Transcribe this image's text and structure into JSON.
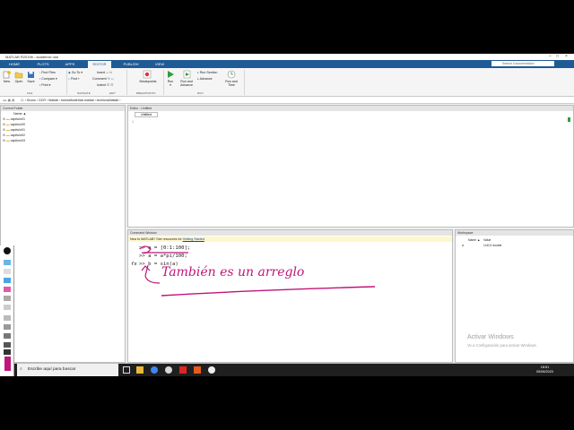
{
  "window": {
    "title": "MATLAB R2019b - academic use"
  },
  "tabs": [
    "HOME",
    "PLOTS",
    "APPS",
    "EDITOR",
    "PUBLISH",
    "VIEW"
  ],
  "search_placeholder": "Search Documentation",
  "ribbon": {
    "file": {
      "new": "New",
      "open": "Open",
      "save": "Save",
      "find_files": "Find Files",
      "compare": "Compare",
      "print": "Print",
      "group": "FILE"
    },
    "navigate": {
      "insert": "Insert",
      "comment": "Comment",
      "indent": "Indent",
      "go_to": "Go To",
      "find": "Find",
      "group": "NAVIGATE"
    },
    "edit_group": "EDIT",
    "breakpoints": {
      "label": "Breakpoints",
      "group": "BREAKPOINTS"
    },
    "run": {
      "run": "Run",
      "run_and_advance": "Run and Advance",
      "run_section": "Run Section",
      "advance": "Advance",
      "run_and_time": "Run and Time",
      "group": "RUN"
    }
  },
  "address_path": "C: › Bruno › GCR › Matlab › tutorialfolderlab-matlab › ArchivosMatlab ›",
  "current_folder": {
    "title": "Current Folder",
    "column": "Name ▲",
    "items": [
      "capitulo01",
      "capitulo00",
      "capitulo01",
      "capitulo02",
      "capitulo03"
    ]
  },
  "editor": {
    "title": "Editor - Untitled",
    "tab": "Untitled",
    "line_number": "1"
  },
  "command_window": {
    "title": "Command Window",
    "notice_text": "New to MATLAB? See resources for ",
    "notice_link": "Getting Started",
    "lines": [
      ">> a = [0:1:100];",
      ">> a = a*pi/100;",
      ">> b = sin(a)"
    ],
    "fx": "fx",
    "annotation": "También es un arreglo"
  },
  "workspace": {
    "title": "Workspace",
    "col_name": "Name ▲",
    "col_value": "Value",
    "var_name": "a",
    "var_value": "1x101 double"
  },
  "watermark": {
    "title": "Activar Windows",
    "subtitle": "Ve a Configuración para activar Windows."
  },
  "taskbar": {
    "search": "Escribe aquí para buscar",
    "time": "18:51",
    "date": "05/08/2020"
  },
  "colors": {
    "ribbon_tab_bg": "#1e5a96",
    "annotation_ink": "#c0157a",
    "taskbar": "#1f1f1f"
  }
}
